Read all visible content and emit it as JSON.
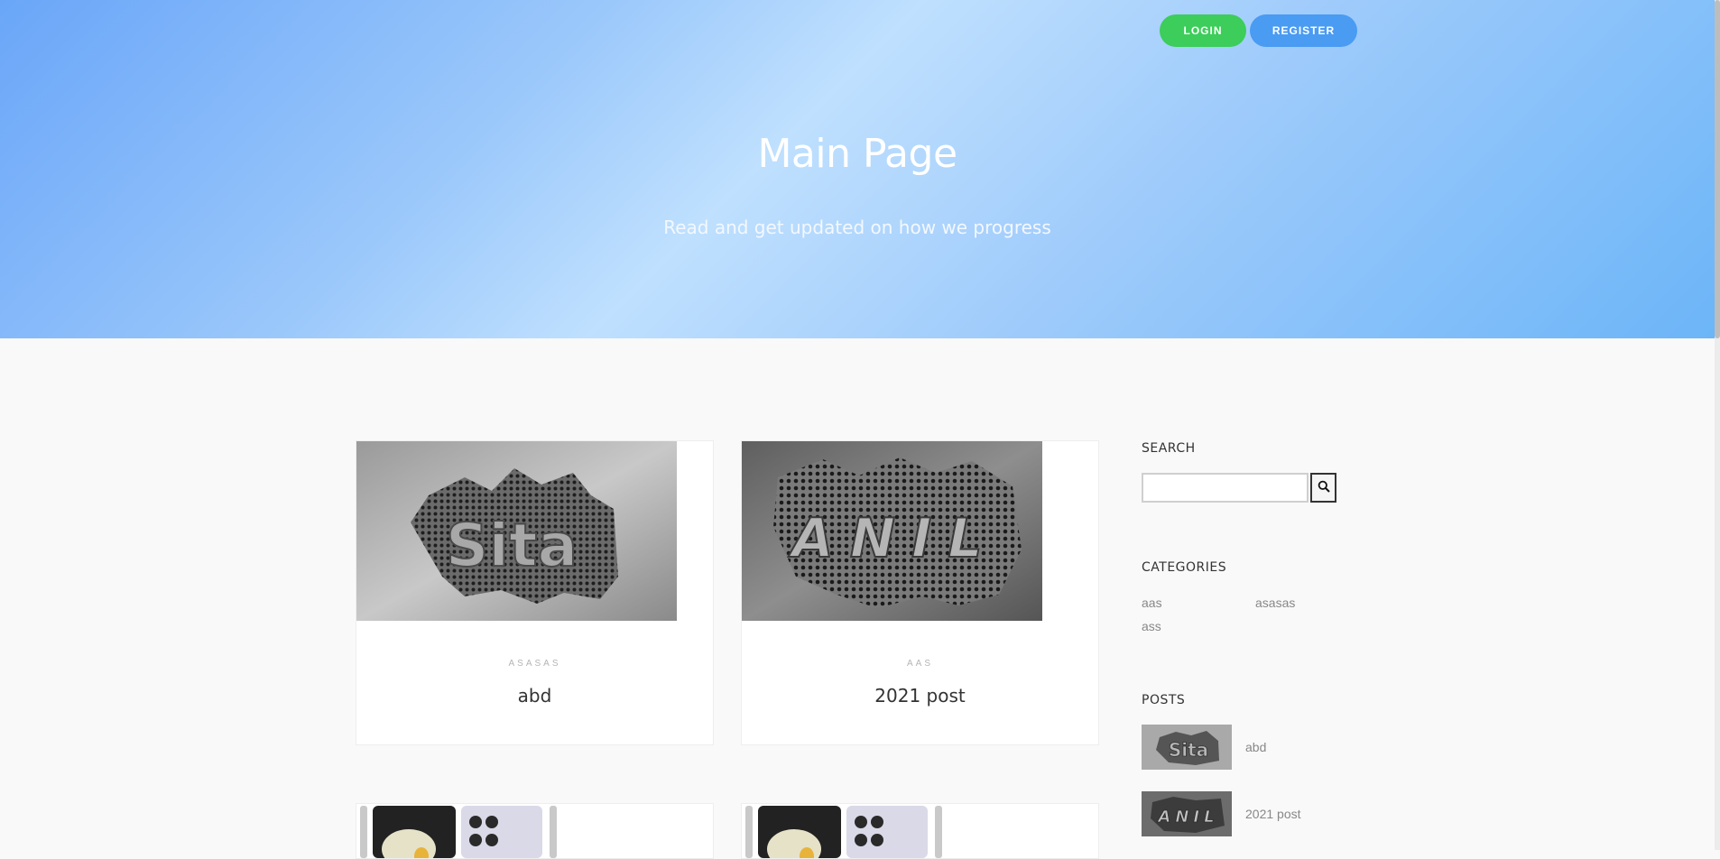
{
  "header": {
    "login_label": "LOGIN",
    "register_label": "REGISTER",
    "title": "Main Page",
    "subtitle": "Read and get updated on how we progress"
  },
  "posts_grid": [
    {
      "category": "ASASAS",
      "title": "abd",
      "image": "sita-metal-logo"
    },
    {
      "category": "AAS",
      "title": "2021 post",
      "image": "anil-metal-logo"
    },
    {
      "category": "",
      "title": "",
      "image": "phone-photo"
    },
    {
      "category": "",
      "title": "",
      "image": "phone-photo"
    }
  ],
  "sidebar": {
    "search_title": "SEARCH",
    "search_placeholder": "",
    "search_icon": "search-icon",
    "categories_title": "CATEGORIES",
    "categories": [
      "aas",
      "asasas",
      "ass"
    ],
    "posts_title": "POSTS",
    "posts": [
      {
        "title": "abd",
        "image": "sita-metal-logo"
      },
      {
        "title": "2021 post",
        "image": "anil-metal-logo"
      }
    ]
  },
  "colors": {
    "login_button": "#3ccd5a",
    "register_button": "#4a9bf2",
    "hero_gradient_start": "#6aa6f8",
    "hero_gradient_end": "#6cb5f8"
  }
}
